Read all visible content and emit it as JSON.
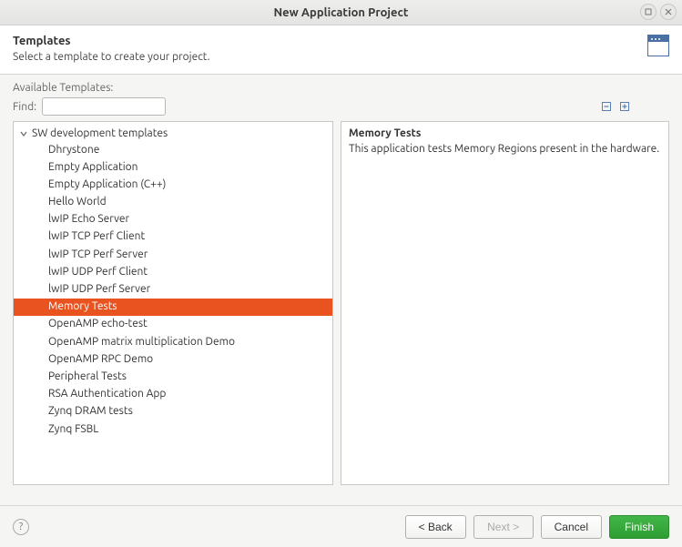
{
  "window": {
    "title": "New Application Project"
  },
  "header": {
    "title": "Templates",
    "subtitle": "Select a template to create your project."
  },
  "available_label": "Available Templates:",
  "find": {
    "label": "Find:",
    "value": ""
  },
  "tree": {
    "group_label": "SW development templates",
    "items": [
      "Dhrystone",
      "Empty Application",
      "Empty Application (C++)",
      "Hello World",
      "lwIP Echo Server",
      "lwIP TCP Perf Client",
      "lwIP TCP Perf Server",
      "lwIP UDP Perf Client",
      "lwIP UDP Perf Server",
      "Memory Tests",
      "OpenAMP echo-test",
      "OpenAMP matrix multiplication Demo",
      "OpenAMP RPC Demo",
      "Peripheral Tests",
      "RSA Authentication App",
      "Zynq DRAM tests",
      "Zynq FSBL"
    ],
    "selected_index": 9
  },
  "description": {
    "title": "Memory Tests",
    "text": "This application tests Memory Regions present in the hardware."
  },
  "buttons": {
    "back": "< Back",
    "next": "Next >",
    "cancel": "Cancel",
    "finish": "Finish"
  }
}
